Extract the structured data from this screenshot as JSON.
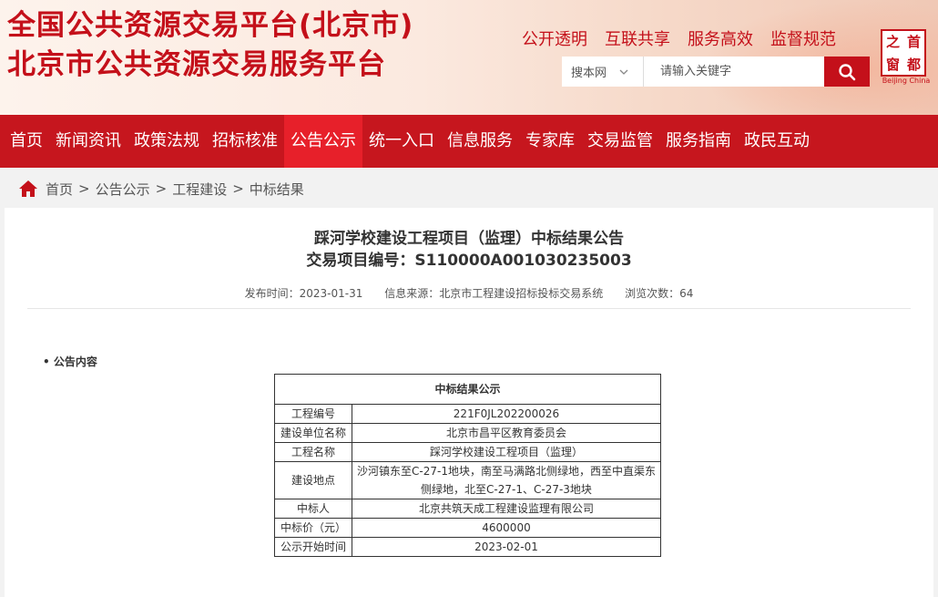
{
  "header": {
    "title_line1": "全国公共资源交易平台(北京市)",
    "title_line2": "北京市公共资源交易服务平台",
    "slogans": [
      "公开透明",
      "互联共享",
      "服务高效",
      "监督规范"
    ],
    "logo_chars": [
      "之",
      "首",
      "窗",
      "都"
    ],
    "logo_en": "Beijing China",
    "search": {
      "scope": "搜本网",
      "scope_icon": "chevron-down-icon",
      "placeholder": "请输入关键字",
      "button_icon": "search-icon"
    }
  },
  "nav": {
    "items": [
      "首页",
      "新闻资讯",
      "政策法规",
      "招标核准",
      "公告公示",
      "统一入口",
      "信息服务",
      "专家库",
      "交易监管",
      "服务指南",
      "政民互动"
    ],
    "active": "公告公示"
  },
  "breadcrumb": {
    "icon": "home-icon",
    "items": [
      "首页",
      "公告公示",
      "工程建设",
      "中标结果"
    ]
  },
  "article": {
    "title": "踩河学校建设工程项目（监理）中标结果公告",
    "code_label": "交易项目编号：S110000A001030235003",
    "publish_time": "发布时间：2023-01-31",
    "source": "信息来源：北京市工程建设招标投标交易系统",
    "views": "浏览次数：64",
    "section_label": "• 公告内容",
    "table": {
      "header": "中标结果公示",
      "rows": [
        {
          "k": "工程编号",
          "v": "221F0JL202200026"
        },
        {
          "k": "建设单位名称",
          "v": "北京市昌平区教育委员会"
        },
        {
          "k": "工程名称",
          "v": "踩河学校建设工程项目（监理）"
        },
        {
          "k": "建设地点",
          "v": "沙河镇东至C-27-1地块，南至马满路北侧绿地，西至中直渠东侧绿地，北至C-27-1、C-27-3地块"
        },
        {
          "k": "中标人",
          "v": "北京共筑天成工程建设监理有限公司"
        },
        {
          "k": "中标价（元）",
          "v": "4600000"
        },
        {
          "k": "公示开始时间",
          "v": "2023-02-01"
        }
      ]
    }
  },
  "colors": {
    "brand_red": "#c4101a",
    "nav_red": "#c6161e",
    "nav_active": "#e7202a"
  }
}
